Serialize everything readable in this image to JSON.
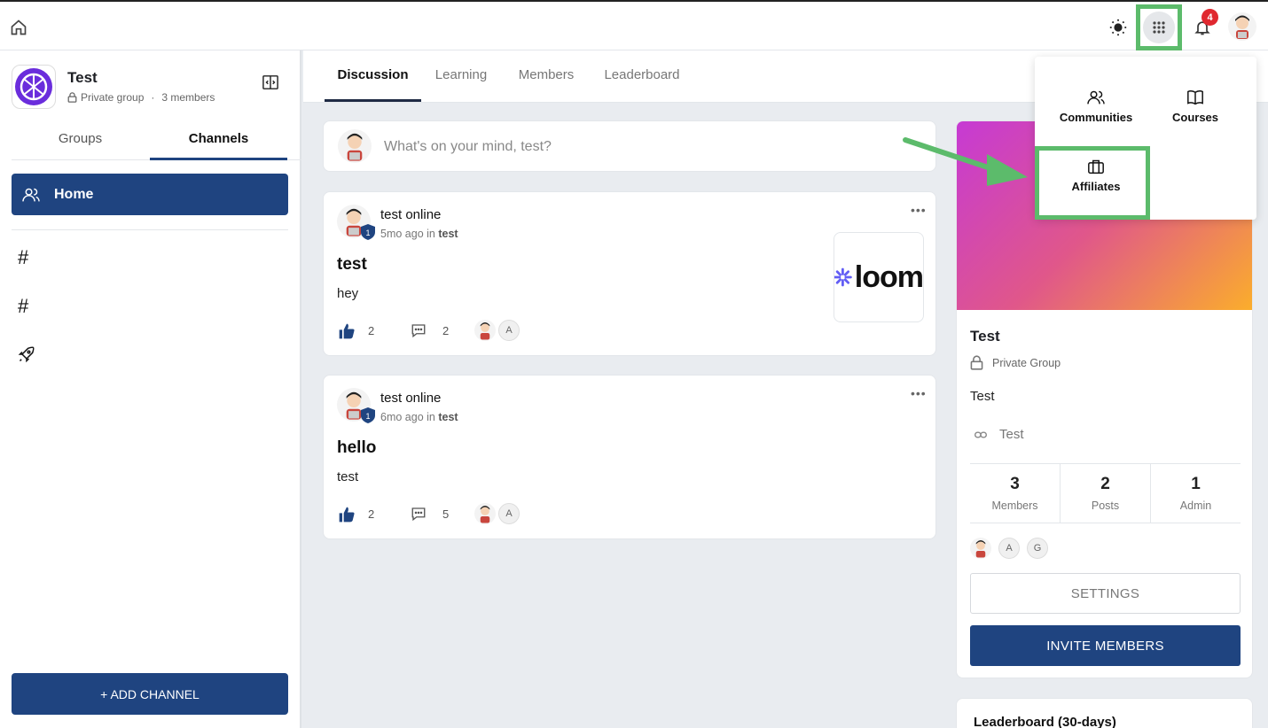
{
  "topbar": {
    "notification_count": "4"
  },
  "group": {
    "name": "Test",
    "privacy": "Private group",
    "separator": "·",
    "members": "3 members"
  },
  "sidebar": {
    "tabs": [
      "Groups",
      "Channels"
    ],
    "active_tab": "Channels",
    "home_label": "Home",
    "channels": [
      {
        "icon": "hash-icon",
        "glyph": "#"
      },
      {
        "icon": "hash-icon",
        "glyph": "#"
      },
      {
        "icon": "rocket-icon",
        "glyph": ""
      }
    ],
    "add_channel_label": "+ ADD CHANNEL"
  },
  "main": {
    "tabs": [
      "Discussion",
      "Learning",
      "Members",
      "Leaderboard"
    ],
    "active_tab": "Discussion"
  },
  "composer": {
    "placeholder": "What's on your mind, test?"
  },
  "posts": [
    {
      "author": "test online",
      "time": "5mo ago",
      "in_label": "in",
      "channel": "test",
      "badge_level": "1",
      "title": "test",
      "body": "hey",
      "likes": "2",
      "comments": "2",
      "reactor_initial": "A",
      "attachment_text": "loom"
    },
    {
      "author": "test online",
      "time": "6mo ago",
      "in_label": "in",
      "channel": "test",
      "badge_level": "1",
      "title": "hello",
      "body": "test",
      "likes": "2",
      "comments": "5",
      "reactor_initial": "A"
    }
  ],
  "group_card": {
    "title": "Test",
    "privacy": "Private Group",
    "description": "Test",
    "link_text": "Test",
    "stats": [
      {
        "value": "3",
        "label": "Members"
      },
      {
        "value": "2",
        "label": "Posts"
      },
      {
        "value": "1",
        "label": "Admin"
      }
    ],
    "member_initials": [
      "A",
      "G"
    ],
    "settings_label": "SETTINGS",
    "invite_label": "INVITE MEMBERS"
  },
  "leaderboard": {
    "title": "Leaderboard (30-days)"
  },
  "apps_menu": {
    "items": [
      {
        "label": "Communities",
        "icon": "users-icon"
      },
      {
        "label": "Courses",
        "icon": "book-icon"
      },
      {
        "label": "Affiliates",
        "icon": "briefcase-icon"
      }
    ]
  },
  "colors": {
    "primary": "#1f4480",
    "highlight": "#5cbb6b",
    "badge": "#e0282f",
    "cover_start": "#c63ad4",
    "cover_end": "#fbae2b"
  }
}
